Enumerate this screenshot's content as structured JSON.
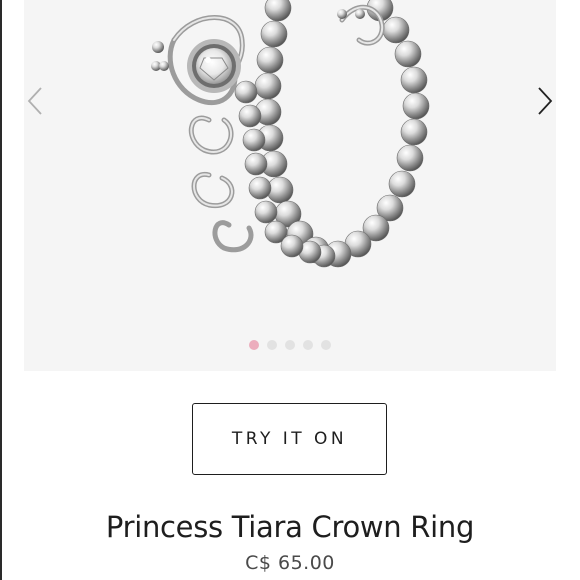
{
  "gallery": {
    "image_alt": "Princess Tiara Crown Ring",
    "slide_count": 5,
    "active_slide": 1,
    "prev_icon": "chevron-left-icon",
    "next_icon": "chevron-right-icon",
    "colors": {
      "background": "#f5f5f5",
      "active_dot": "#ecadbd",
      "inactive_dot": "#e2e2e2"
    }
  },
  "actions": {
    "try_on_label": "TRY IT ON"
  },
  "product": {
    "title": "Princess Tiara Crown Ring",
    "price": "C$ 65.00"
  }
}
